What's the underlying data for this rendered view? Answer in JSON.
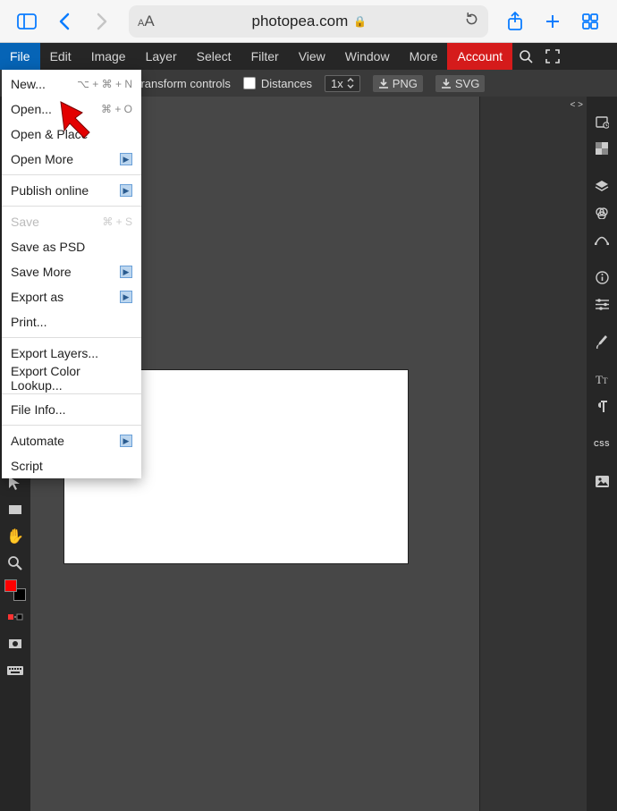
{
  "browser": {
    "url_host": "photopea.com"
  },
  "menu": {
    "file": "File",
    "edit": "Edit",
    "image": "Image",
    "layer": "Layer",
    "select": "Select",
    "filter": "Filter",
    "view": "View",
    "window": "Window",
    "more": "More",
    "account": "Account"
  },
  "options": {
    "transform_controls": "Transform controls",
    "distances": "Distances",
    "zoom": "1x",
    "png": "PNG",
    "svg": "SVG"
  },
  "file_menu": {
    "new": "New...",
    "new_short": "⌥ + ⌘ + N",
    "open": "Open...",
    "open_short": "⌘ + O",
    "open_place": "Open & Place",
    "open_more": "Open More",
    "publish": "Publish online",
    "save": "Save",
    "save_short": "⌘ + S",
    "save_psd": "Save as PSD",
    "save_more": "Save More",
    "export_as": "Export as",
    "print": "Print...",
    "export_layers": "Export Layers...",
    "export_lookup": "Export Color Lookup...",
    "file_info": "File Info...",
    "automate": "Automate",
    "script": "Script"
  },
  "panels": {
    "css": "CSS",
    "code_toggle": "< >"
  }
}
